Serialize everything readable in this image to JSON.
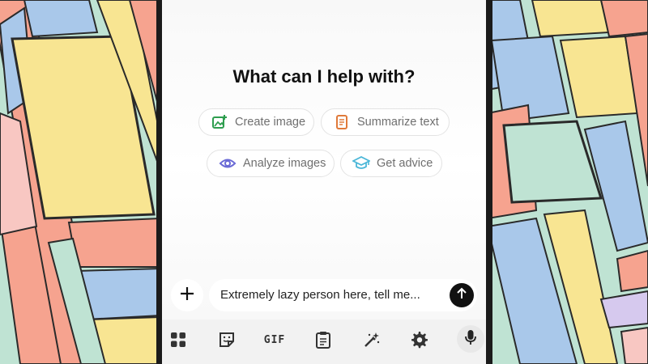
{
  "heading": "What can I help with?",
  "chips": [
    {
      "label": "Create image",
      "icon": "image-plus-icon",
      "color": "#2e9e4f"
    },
    {
      "label": "Summarize text",
      "icon": "document-icon",
      "color": "#e07a3a"
    },
    {
      "label": "Analyze images",
      "icon": "eye-icon",
      "color": "#6a6ad6"
    },
    {
      "label": "Get advice",
      "icon": "graduation-cap-icon",
      "color": "#4bb7d8"
    }
  ],
  "composer": {
    "text": "Extremely lazy person here, tell me...",
    "plus_icon": "plus-icon",
    "send_icon": "arrow-up-icon"
  },
  "keyboard_toolbar": {
    "items": [
      "apps-grid-icon",
      "sticker-icon",
      "gif",
      "clipboard-icon",
      "magic-wand-icon",
      "gear-icon",
      "microphone-icon"
    ],
    "gif_label": "GIF"
  }
}
